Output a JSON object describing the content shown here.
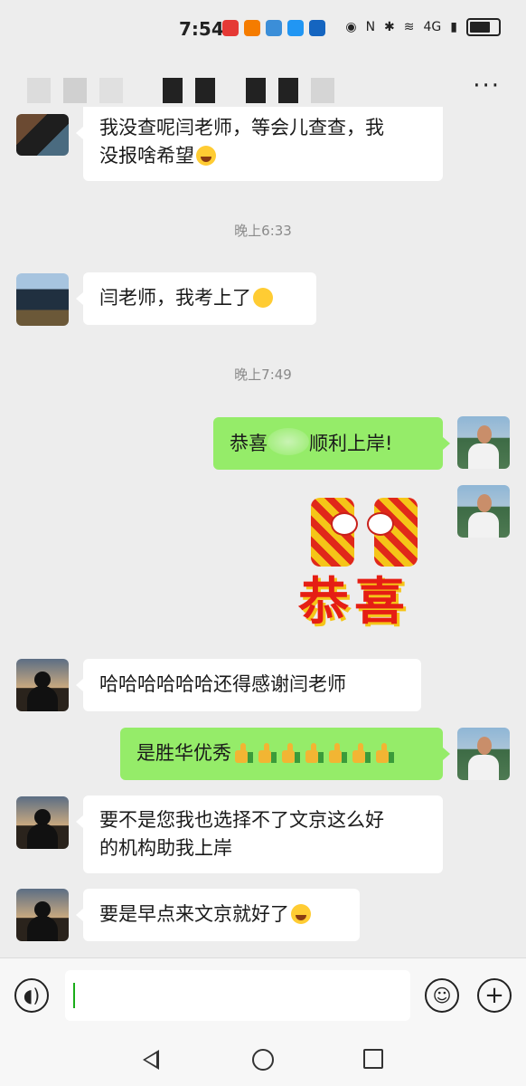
{
  "status": {
    "time": "7:54",
    "network": "4G",
    "signal_label": "6"
  },
  "header": {
    "title": "",
    "more_label": "···"
  },
  "messages": [
    {
      "side": "left",
      "text": "我没查呢闫老师，等会儿查查，我",
      "text2": "没报啥希望",
      "emoji": "laugh"
    },
    {
      "type": "time",
      "text": "晚上6:33"
    },
    {
      "side": "left",
      "text": "闫老师，我考上了",
      "emoji": "grin"
    },
    {
      "type": "time",
      "text": "晚上7:49"
    },
    {
      "side": "right",
      "text_a": "恭喜",
      "text_b": "顺利上岸!"
    },
    {
      "side": "right",
      "sticker_text": "恭喜"
    },
    {
      "side": "left",
      "text": "哈哈哈哈哈哈还得感谢闫老师"
    },
    {
      "side": "right",
      "text": "是胜华优秀",
      "thumbs": 7
    },
    {
      "side": "left",
      "text": "要不是您我也选择不了文京这么好",
      "text2": "的机构助我上岸"
    },
    {
      "side": "left",
      "text": "要是早点来文京就好了",
      "emoji": "laugh"
    }
  ],
  "input": {
    "voice_icon": "voice-icon",
    "emoji_icon": "emoji-icon",
    "plus_icon": "plus-icon"
  },
  "colors": {
    "background": "#ededed",
    "bubble_self": "#95ec69",
    "bubble_other": "#ffffff",
    "accent": "#1aad19"
  }
}
